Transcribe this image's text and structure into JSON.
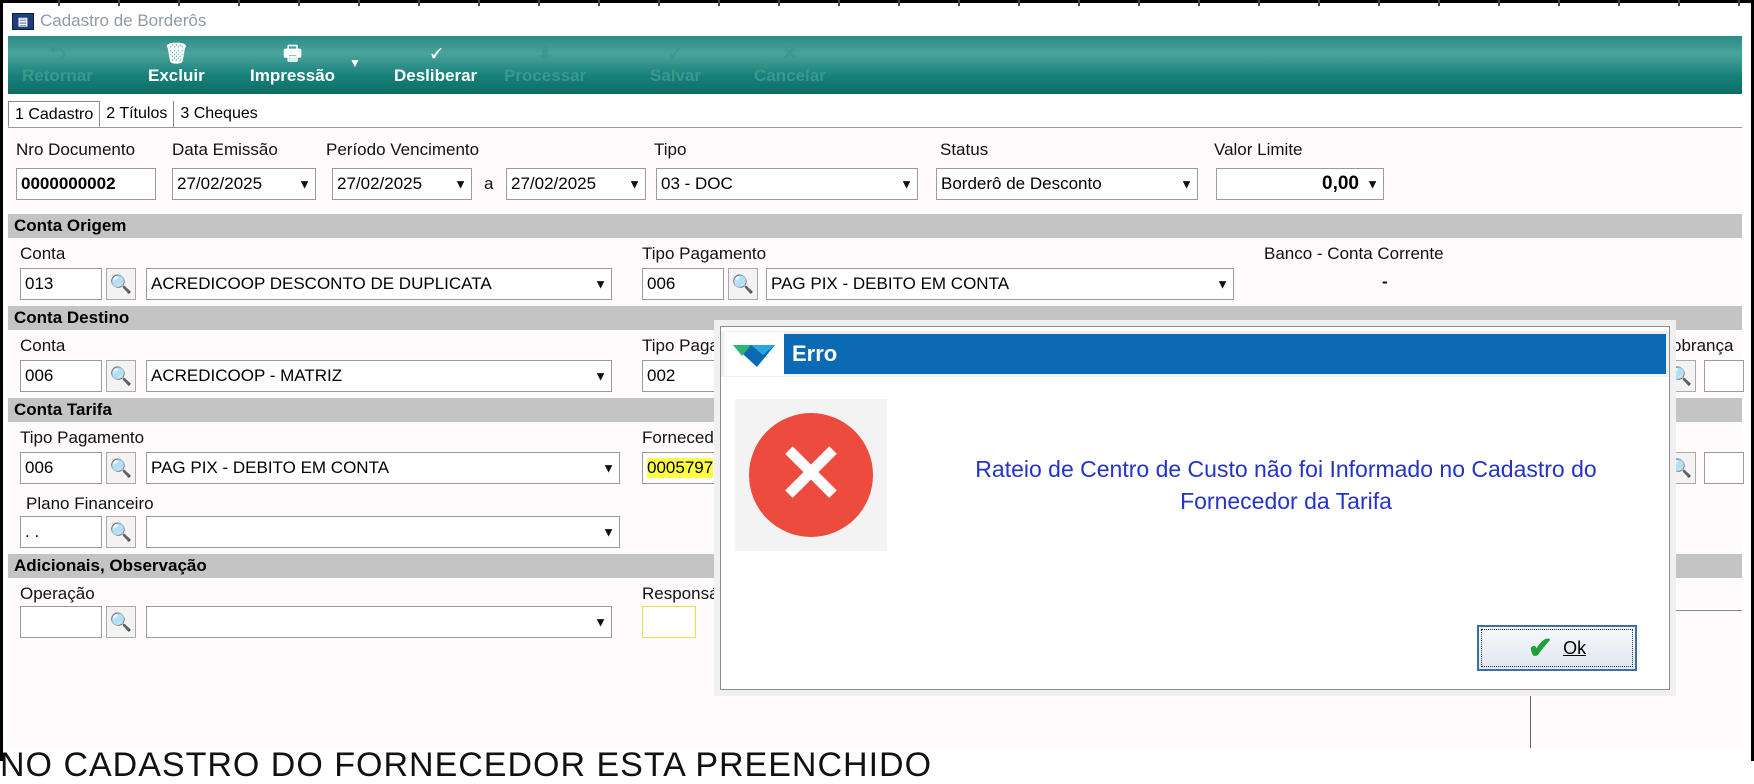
{
  "window": {
    "title": "Cadastro de Borderôs"
  },
  "toolbar": {
    "items": [
      {
        "label": "Retornar",
        "icon": "return-icon",
        "enabled": false
      },
      {
        "label": "Excluir",
        "icon": "trash-icon",
        "enabled": true
      },
      {
        "label": "Impressão",
        "icon": "printer-icon",
        "enabled": true
      },
      {
        "label": "Desliberar",
        "icon": "unlock-icon",
        "enabled": true
      },
      {
        "label": "Processar",
        "icon": "process-icon",
        "enabled": false
      },
      {
        "label": "Salvar",
        "icon": "check-icon",
        "enabled": false
      },
      {
        "label": "Cancelar",
        "icon": "cancel-icon",
        "enabled": false
      }
    ]
  },
  "tabs": [
    {
      "label": "1 Cadastro",
      "active": true
    },
    {
      "label": "2 Títulos",
      "active": false
    },
    {
      "label": "3 Cheques",
      "active": false
    }
  ],
  "header_fields": {
    "nro_documento": {
      "label": "Nro Documento",
      "value": "0000000002"
    },
    "data_emissao": {
      "label": "Data Emissão",
      "value": "27/02/2025"
    },
    "periodo_vencimento": {
      "label": "Período Vencimento",
      "from": "27/02/2025",
      "sep": "a",
      "to": "27/02/2025"
    },
    "tipo": {
      "label": "Tipo",
      "value": "03 - DOC"
    },
    "status": {
      "label": "Status",
      "value": "Borderô de Desconto"
    },
    "valor_limite": {
      "label": "Valor Limite",
      "value": "0,00"
    }
  },
  "conta_origem": {
    "section": "Conta Origem",
    "conta_label": "Conta",
    "conta_code": "013",
    "conta_name": "ACREDICOOP DESCONTO DE DUPLICATA",
    "tipo_pag_label": "Tipo Pagamento",
    "tipo_pag_code": "006",
    "tipo_pag_name": "PAG PIX - DEBITO EM CONTA",
    "banco_label": "Banco - Conta Corrente",
    "banco_value": "-"
  },
  "conta_destino": {
    "section": "Conta Destino",
    "conta_label": "Conta",
    "conta_code": "006",
    "conta_name": "ACREDICOOP - MATRIZ",
    "tipo_pag_label": "Tipo Paga",
    "tipo_pag_code": "002",
    "cobranca_label": "obrança"
  },
  "conta_tarifa": {
    "section": "Conta Tarifa",
    "tipo_pag_label": "Tipo Pagamento",
    "tipo_pag_code": "006",
    "tipo_pag_name": "PAG PIX - DEBITO EM CONTA",
    "fornecedor_label": "Forneced",
    "fornecedor_code": "0005797",
    "plano_label": "Plano Financeiro",
    "plano_value": ". ."
  },
  "adicionais": {
    "section": "Adicionais, Observação",
    "operacao_label": "Operação",
    "responsavel_label": "Responsá"
  },
  "background_text": "NO CADASTRO DO FORNECEDOR ESTA PREENCHIDO",
  "dialog": {
    "title": "Erro",
    "message_line1": "Rateio de Centro de Custo não foi Informado no Cadastro do",
    "message_line2": "Fornecedor da Tarifa",
    "ok_label": "Ok",
    "colors": {
      "title_bar": "#0c69b4",
      "message": "#2334c8",
      "error": "#ee4b3f"
    }
  }
}
